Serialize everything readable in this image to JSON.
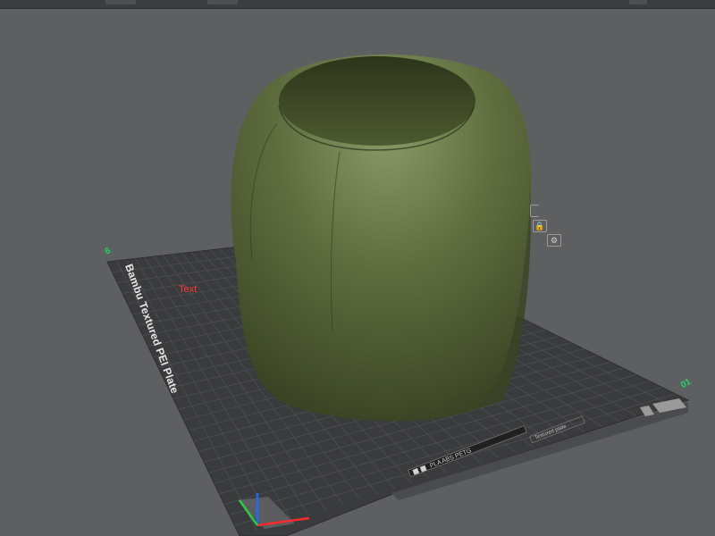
{
  "app": {
    "accent": "#3b3d3f"
  },
  "plate": {
    "name": "Bambu Textured PEI Plate",
    "text_tag": "Text",
    "axis_num_left": "6",
    "axis_num_right": "01",
    "filament_label": "PLA ABS PETG",
    "small_label": "Textured plate",
    "colors": {
      "bed": "#3a3b3d",
      "grid": "#4c4e52",
      "model": "#5d6b3e"
    }
  },
  "icons": {
    "orient": "orient-icon",
    "lock": "lock-icon",
    "gear": "settings-icon",
    "axis": "axis-gizmo-icon"
  },
  "icon_glyphs": {
    "lock": "🔒",
    "gear": "⚙"
  }
}
